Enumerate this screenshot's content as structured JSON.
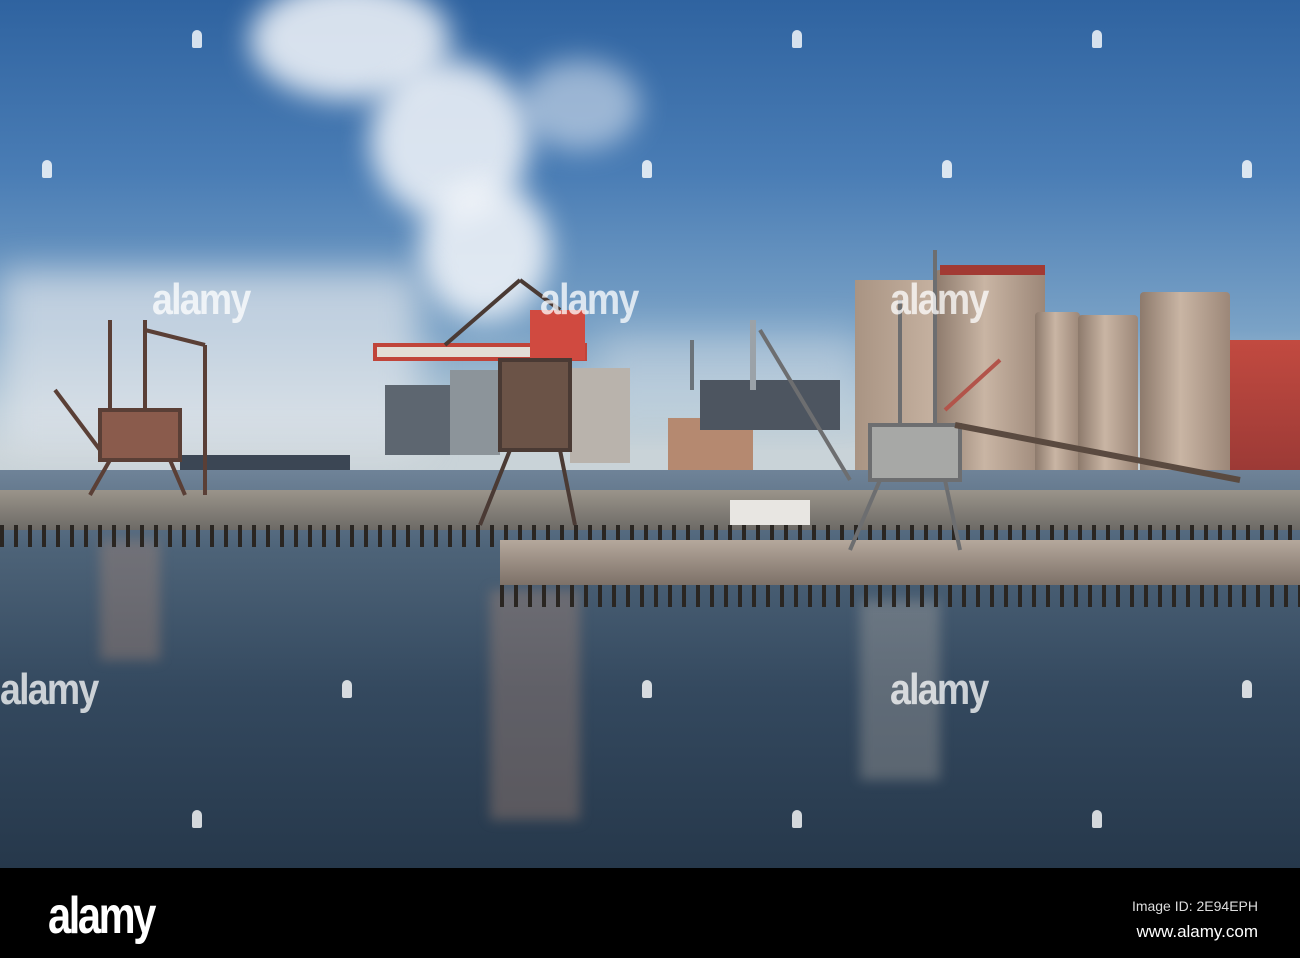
{
  "photo": {
    "subject": "industrial harbour with cranes and silos",
    "watermark": "alamy"
  },
  "footer": {
    "logo": "alamy",
    "image_id": "Image ID: 2E94EPH",
    "url": "www.alamy.com"
  }
}
